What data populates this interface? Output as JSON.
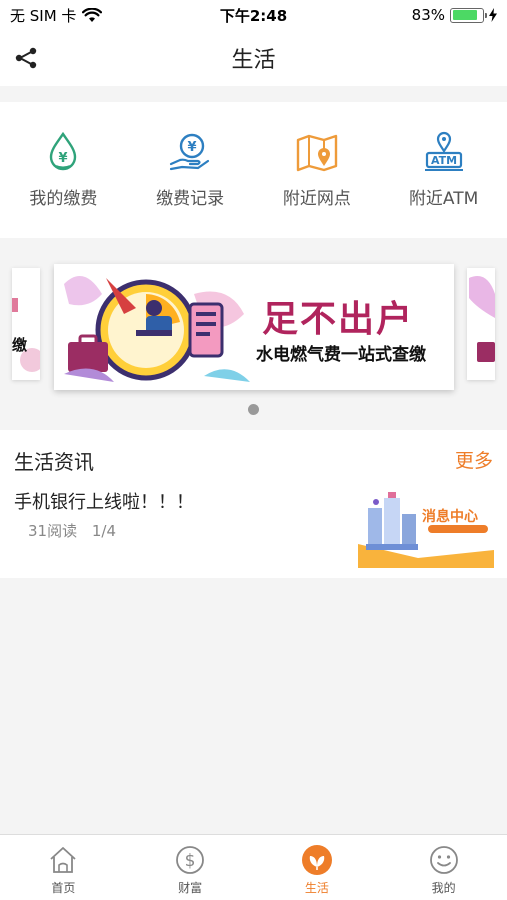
{
  "status_bar": {
    "carrier": "无 SIM 卡",
    "time": "下午2:48",
    "battery_percent": "83%",
    "battery_level": 0.83
  },
  "nav": {
    "title": "生活"
  },
  "quick_services": [
    {
      "label": "我的缴费",
      "icon": "water-drop-yen-icon",
      "color": "#2fa37a"
    },
    {
      "label": "缴费记录",
      "icon": "hand-yen-icon",
      "color": "#2d7fc1"
    },
    {
      "label": "附近网点",
      "icon": "map-pin-icon",
      "color": "#ee9b3a"
    },
    {
      "label": "附近ATM",
      "icon": "atm-pin-icon",
      "color": "#2d7fc1"
    }
  ],
  "banner": {
    "headline": "足不出户",
    "subtitle": "水电燃气费一站式查缴",
    "side_text": "缴"
  },
  "news": {
    "section_title": "生活资讯",
    "more_label": "更多",
    "items": [
      {
        "title": "手机银行上线啦！！！",
        "reads": "31阅读",
        "page": "1/4",
        "thumb_text": "消息中心"
      }
    ]
  },
  "tabs": [
    {
      "label": "首页",
      "icon": "home-icon"
    },
    {
      "label": "财富",
      "icon": "dollar-circle-icon"
    },
    {
      "label": "生活",
      "icon": "leaf-icon",
      "active": true
    },
    {
      "label": "我的",
      "icon": "smile-face-icon"
    }
  ],
  "colors": {
    "accent": "#ee7d29",
    "banner_headline": "#b0245d"
  }
}
